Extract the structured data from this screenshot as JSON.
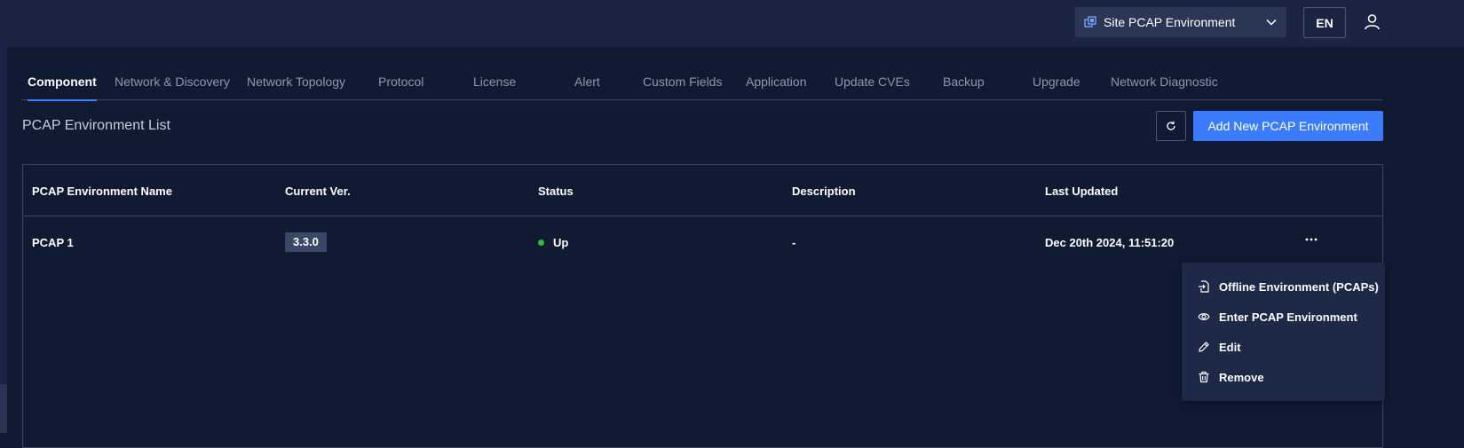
{
  "header": {
    "environment_select": {
      "value": "Site PCAP Environment",
      "icon": "environment-icon"
    },
    "language_button": "EN",
    "user_icon": "user-icon"
  },
  "tabs": [
    {
      "label": "Component",
      "active": true
    },
    {
      "label": "Network & Discovery",
      "active": false
    },
    {
      "label": "Network Topology",
      "active": false
    },
    {
      "label": "Protocol",
      "active": false
    },
    {
      "label": "License",
      "active": false
    },
    {
      "label": "Alert",
      "active": false
    },
    {
      "label": "Custom Fields",
      "active": false
    },
    {
      "label": "Application",
      "active": false
    },
    {
      "label": "Update CVEs",
      "active": false
    },
    {
      "label": "Backup",
      "active": false
    },
    {
      "label": "Upgrade",
      "active": false
    },
    {
      "label": "Network Diagnostic",
      "active": false
    }
  ],
  "list": {
    "title": "PCAP Environment List",
    "refresh_icon": "refresh-icon",
    "add_button": "Add New PCAP Environment"
  },
  "table": {
    "columns": [
      "PCAP Environment Name",
      "Current Ver.",
      "Status",
      "Description",
      "Last Updated"
    ],
    "rows": [
      {
        "name": "PCAP 1",
        "version": "3.3.0",
        "status": "Up",
        "status_color": "#2ebd3d",
        "description": "-",
        "last_updated": "Dec 20th 2024, 11:51:20"
      }
    ]
  },
  "context_menu": {
    "items": [
      {
        "label": "Offline Environment (PCAPs)",
        "icon": "file-import-icon"
      },
      {
        "label": "Enter PCAP Environment",
        "icon": "eye-icon"
      },
      {
        "label": "Edit",
        "icon": "pencil-icon"
      },
      {
        "label": "Remove",
        "icon": "trash-icon"
      }
    ]
  },
  "colors": {
    "background": "#111a33",
    "topbar": "#1b2444",
    "accent": "#3b7cff",
    "status_up": "#2ebd3d"
  }
}
